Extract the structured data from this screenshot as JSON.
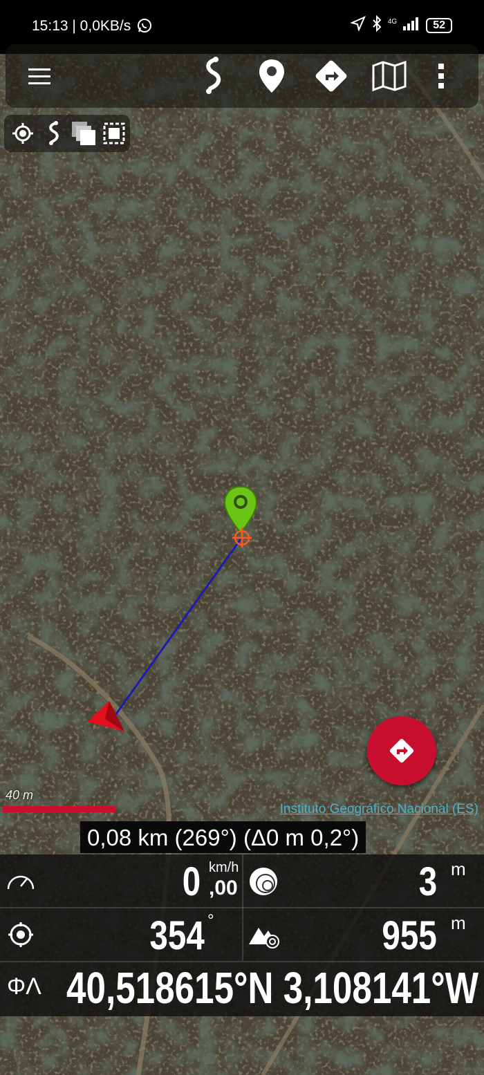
{
  "status_bar": {
    "time": "15:13 | 0,0KB/s",
    "network": "4G",
    "battery": "52"
  },
  "toolbar": {
    "icons": [
      "menu-icon",
      "track-icon",
      "waypoint-icon",
      "route-icon",
      "map-layers-icon",
      "overflow-icon"
    ]
  },
  "mini_toolbar": {
    "icons": [
      "center-location-icon",
      "track-small-icon",
      "layers-copy-icon",
      "select-area-icon"
    ]
  },
  "map": {
    "scale_label": "40 m",
    "attribution": "Instituto Geográfico Nacional (ES)",
    "colors": {
      "scale": "#c8102e",
      "waypoint": "#6cc417",
      "arrow": "#e0101e",
      "line": "#1c1cb0"
    }
  },
  "navigation": {
    "distance_text": "0,08 km (269°) (Δ0 m 0,2°)"
  },
  "dashboard": {
    "speed_value": "0",
    "speed_decimal": ",00",
    "speed_unit": "km/h",
    "accuracy_value": "3",
    "accuracy_unit": "m",
    "bearing_value": "354",
    "bearing_unit": "°",
    "altitude_value": "955",
    "altitude_unit": "m",
    "coord_label": "ΦΛ",
    "coordinates": "40,518615°N 3,108141°W"
  }
}
